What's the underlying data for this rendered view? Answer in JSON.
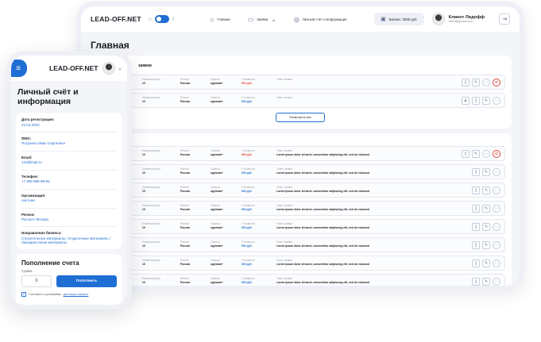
{
  "desktop": {
    "logo": "LEAD-OFF.NET",
    "nav": [
      {
        "label": "Главная",
        "icon": "home-icon"
      },
      {
        "label": "Заявки",
        "icon": "requests-icon"
      },
      {
        "label": "Личный счёт и информация",
        "icon": "account-icon"
      }
    ],
    "balance": "Баланс: 3000 руб.",
    "user": {
      "name": "Клиент Лидофф",
      "email": "client@gmail.com"
    },
    "page_title": "Главная",
    "section1_title": "заявки",
    "show_all": "Посмотреть все",
    "row_labels": {
      "group": "...рная группа",
      "group_val": "...ала",
      "nom": "Номенклатура",
      "nom_val": "10",
      "reg": "Регион",
      "reg_val": "Россия",
      "grade": "Оценка",
      "grade_val": "крупная+",
      "cost": "Стоимость",
      "cost_val": "500 руб.",
      "text": "Текст заявки",
      "text_val": "Lorem ipsum dolor sit amet, consectetur adipiscing elit, sed do eiusmod"
    }
  },
  "mobile": {
    "logo": "LEAD-OFF.NET",
    "title": "Личный счёт и информация",
    "fields": [
      {
        "label": "Дата регистрации:",
        "value": "24.04.2023"
      },
      {
        "label": "ФИО:",
        "value": "Потрахно Иван Сергеевич"
      },
      {
        "label": "Email:",
        "value": "123@mail.ru"
      },
      {
        "label": "Телефон:",
        "value": "+7 999 999-99-99"
      },
      {
        "label": "Организация:",
        "value": "частная"
      },
      {
        "label": "Регион:",
        "value": "Россия / Москва"
      },
      {
        "label": "Направление бизнеса:",
        "value": "Строительные материалы / Отделочные материалы / Лакокрасочные материалы"
      }
    ],
    "topup": {
      "title": "Пополнение счета",
      "sum_label": "Сумма",
      "sum_value": "0",
      "button": "Пополнить",
      "agree_text": "Согласен с условиями",
      "agree_link": "договора оферты"
    }
  },
  "colors": {
    "accent": "#1f6ed4",
    "danger": "#e1443b"
  }
}
